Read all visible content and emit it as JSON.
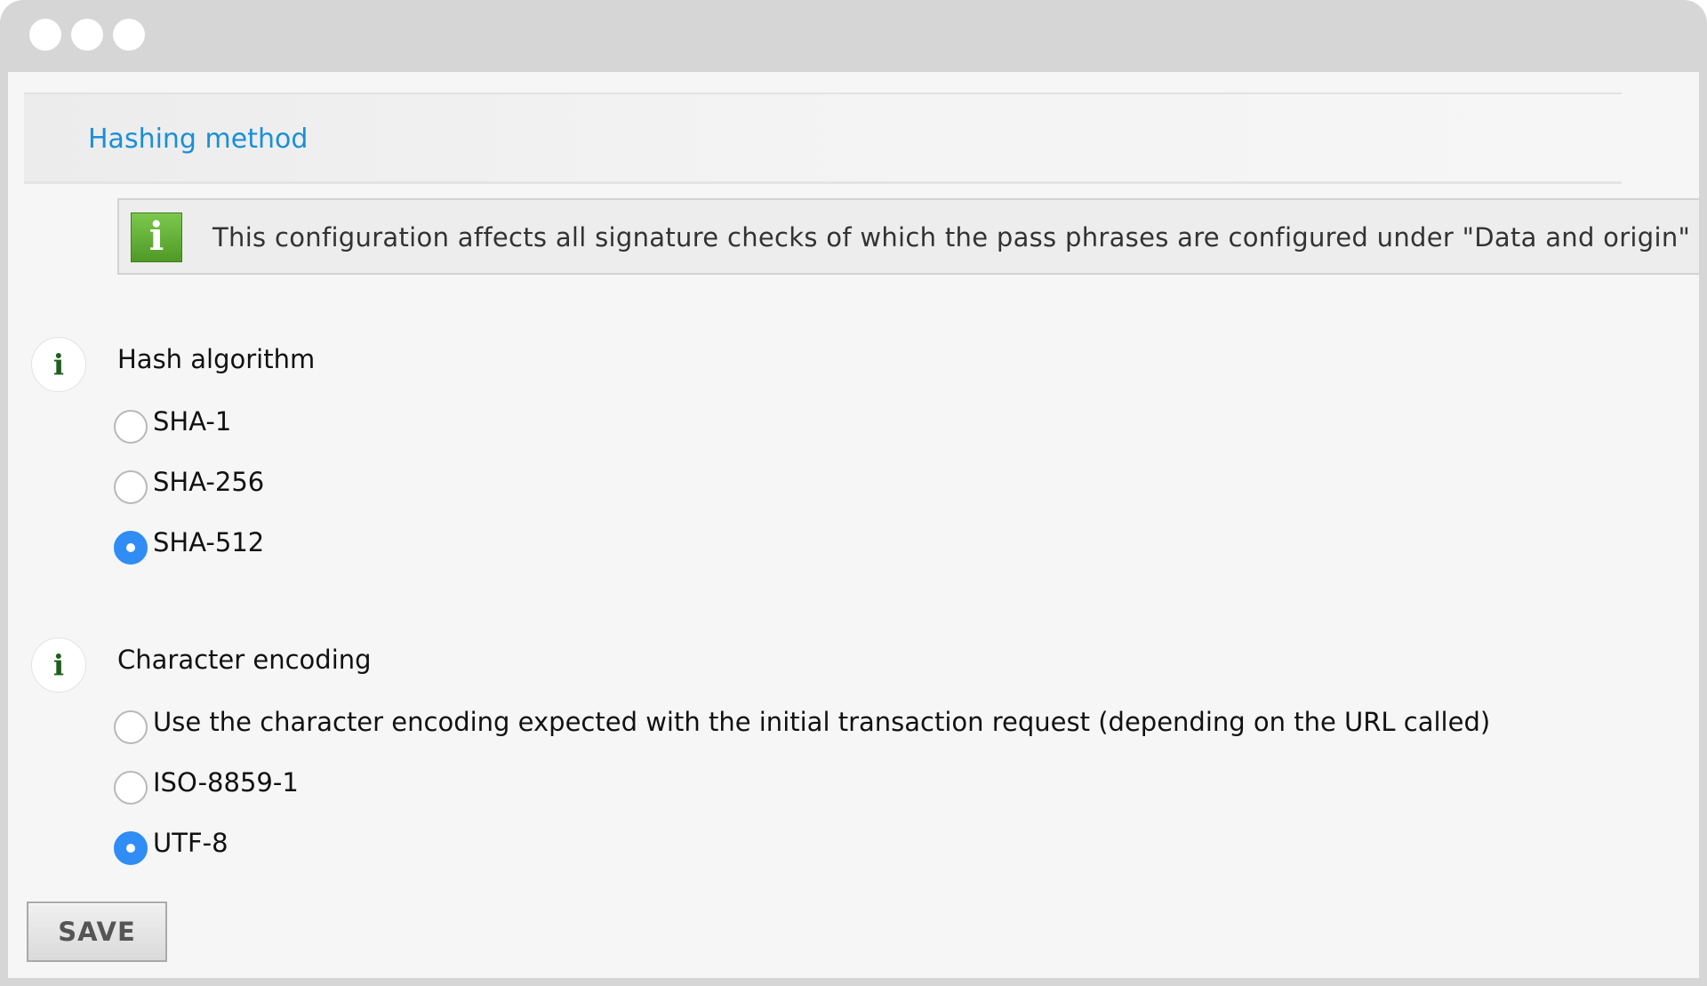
{
  "section": {
    "title": "Hashing method"
  },
  "notice": {
    "icon": "info-icon",
    "text": "This configuration affects all signature checks of which the pass phrases are configured under \"Data and origin\""
  },
  "hash_algorithm": {
    "label": "Hash algorithm",
    "options": [
      {
        "label": "SHA-1",
        "checked": false
      },
      {
        "label": "SHA-256",
        "checked": false
      },
      {
        "label": "SHA-512",
        "checked": true
      }
    ]
  },
  "character_encoding": {
    "label": "Character encoding",
    "options": [
      {
        "label": "Use the character encoding expected with the initial transaction request (depending on the URL called)",
        "checked": false
      },
      {
        "label": "ISO-8859-1",
        "checked": false
      },
      {
        "label": "UTF-8",
        "checked": true
      }
    ]
  },
  "actions": {
    "save_label": "SAVE"
  },
  "colors": {
    "accent": "#2f8df5",
    "title": "#1b8fd6",
    "notice_icon": "#5fae33"
  }
}
